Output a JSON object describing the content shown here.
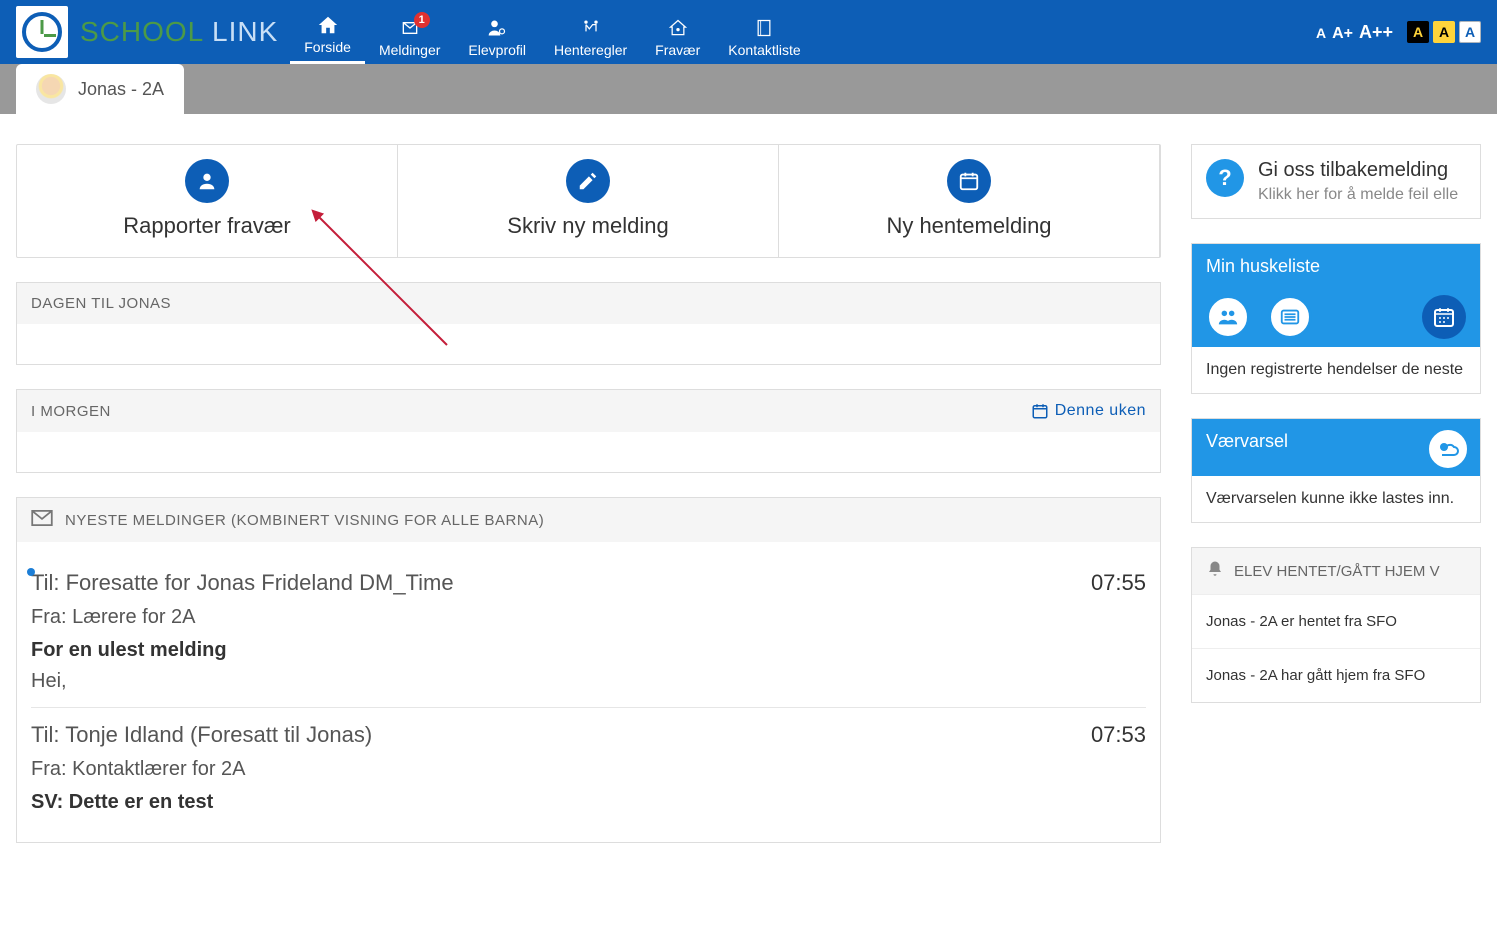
{
  "brand": {
    "part1": "SCHOOL",
    "part2": " LINK"
  },
  "nav": {
    "forside": "Forside",
    "meldinger": "Meldinger",
    "meldinger_badge": "1",
    "elevprofil": "Elevprofil",
    "henteregler": "Henteregler",
    "fravaer": "Fravær",
    "kontaktliste": "Kontaktliste"
  },
  "font_buttons": {
    "a": "A",
    "ap": "A+",
    "app": "A++"
  },
  "contrast_a": "A",
  "student_tab": "Jonas - 2A",
  "actions": {
    "rapporter": "Rapporter fravær",
    "skriv": "Skriv ny melding",
    "hente": "Ny hentemelding"
  },
  "day_panel_title": "DAGEN TIL JONAS",
  "tomorrow_panel_title": "I MORGEN",
  "week_link": "Denne uken",
  "messages_panel_title": "NYESTE MELDINGER (KOMBINERT VISNING FOR ALLE BARNA)",
  "messages": [
    {
      "to": "Til: Foresatte for Jonas Frideland DM_Time",
      "from": "Fra: Lærere for 2A",
      "subject": "For en ulest melding",
      "preview": "Hei,",
      "time": "07:55",
      "unread": true
    },
    {
      "to": "Til: Tonje Idland (Foresatt til Jonas)",
      "from": "Fra: Kontaktlærer for 2A",
      "subject": "SV: Dette er en test",
      "preview": "",
      "time": "07:53",
      "unread": false
    }
  ],
  "feedback": {
    "title": "Gi oss tilbakemelding",
    "subtitle": "Klikk her for å melde feil elle"
  },
  "huskeliste": {
    "title": "Min huskeliste",
    "body": "Ingen registrerte hendelser de neste"
  },
  "weather": {
    "title": "Værvarsel",
    "body": "Værvarselen kunne ikke lastes inn."
  },
  "pickup": {
    "title": "ELEV HENTET/GÅTT HJEM V",
    "rows": [
      "Jonas - 2A er hentet fra SFO",
      "Jonas - 2A har gått hjem fra SFO"
    ]
  }
}
